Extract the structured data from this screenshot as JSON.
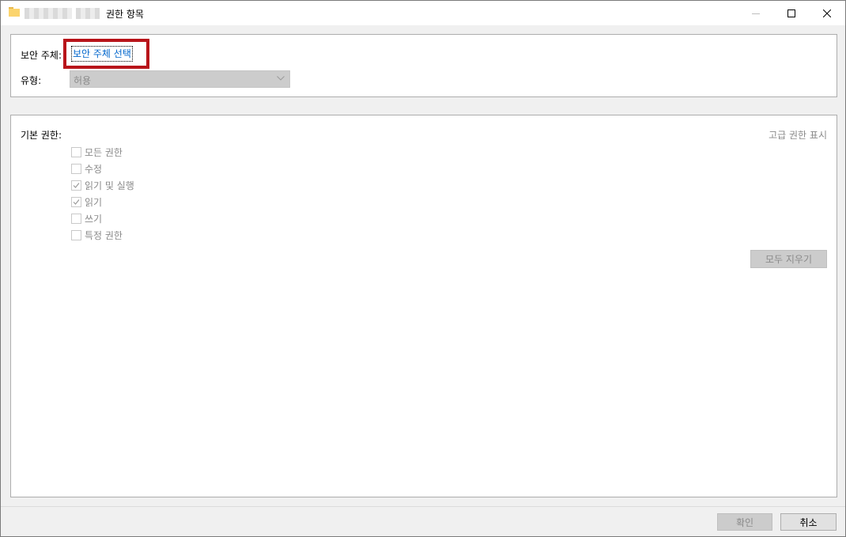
{
  "window": {
    "title": "권한 항목"
  },
  "principal": {
    "label": "보안 주체:",
    "link_text": "보안 주체 선택"
  },
  "type": {
    "label": "유형:",
    "selected": "허용"
  },
  "permissions": {
    "label": "기본 권한:",
    "advanced_link": "고급 권한 표시",
    "items": [
      {
        "label": "모든 권한",
        "checked": false
      },
      {
        "label": "수정",
        "checked": false
      },
      {
        "label": "읽기 및 실행",
        "checked": true
      },
      {
        "label": "읽기",
        "checked": true
      },
      {
        "label": "쓰기",
        "checked": false
      },
      {
        "label": "특정 권한",
        "checked": false
      }
    ],
    "clear_all_label": "모두 지우기"
  },
  "footer": {
    "ok_label": "확인",
    "cancel_label": "취소"
  },
  "colors": {
    "link": "#0066cc",
    "highlight": "#b8141a",
    "disabled_text": "#8a8a8a"
  }
}
